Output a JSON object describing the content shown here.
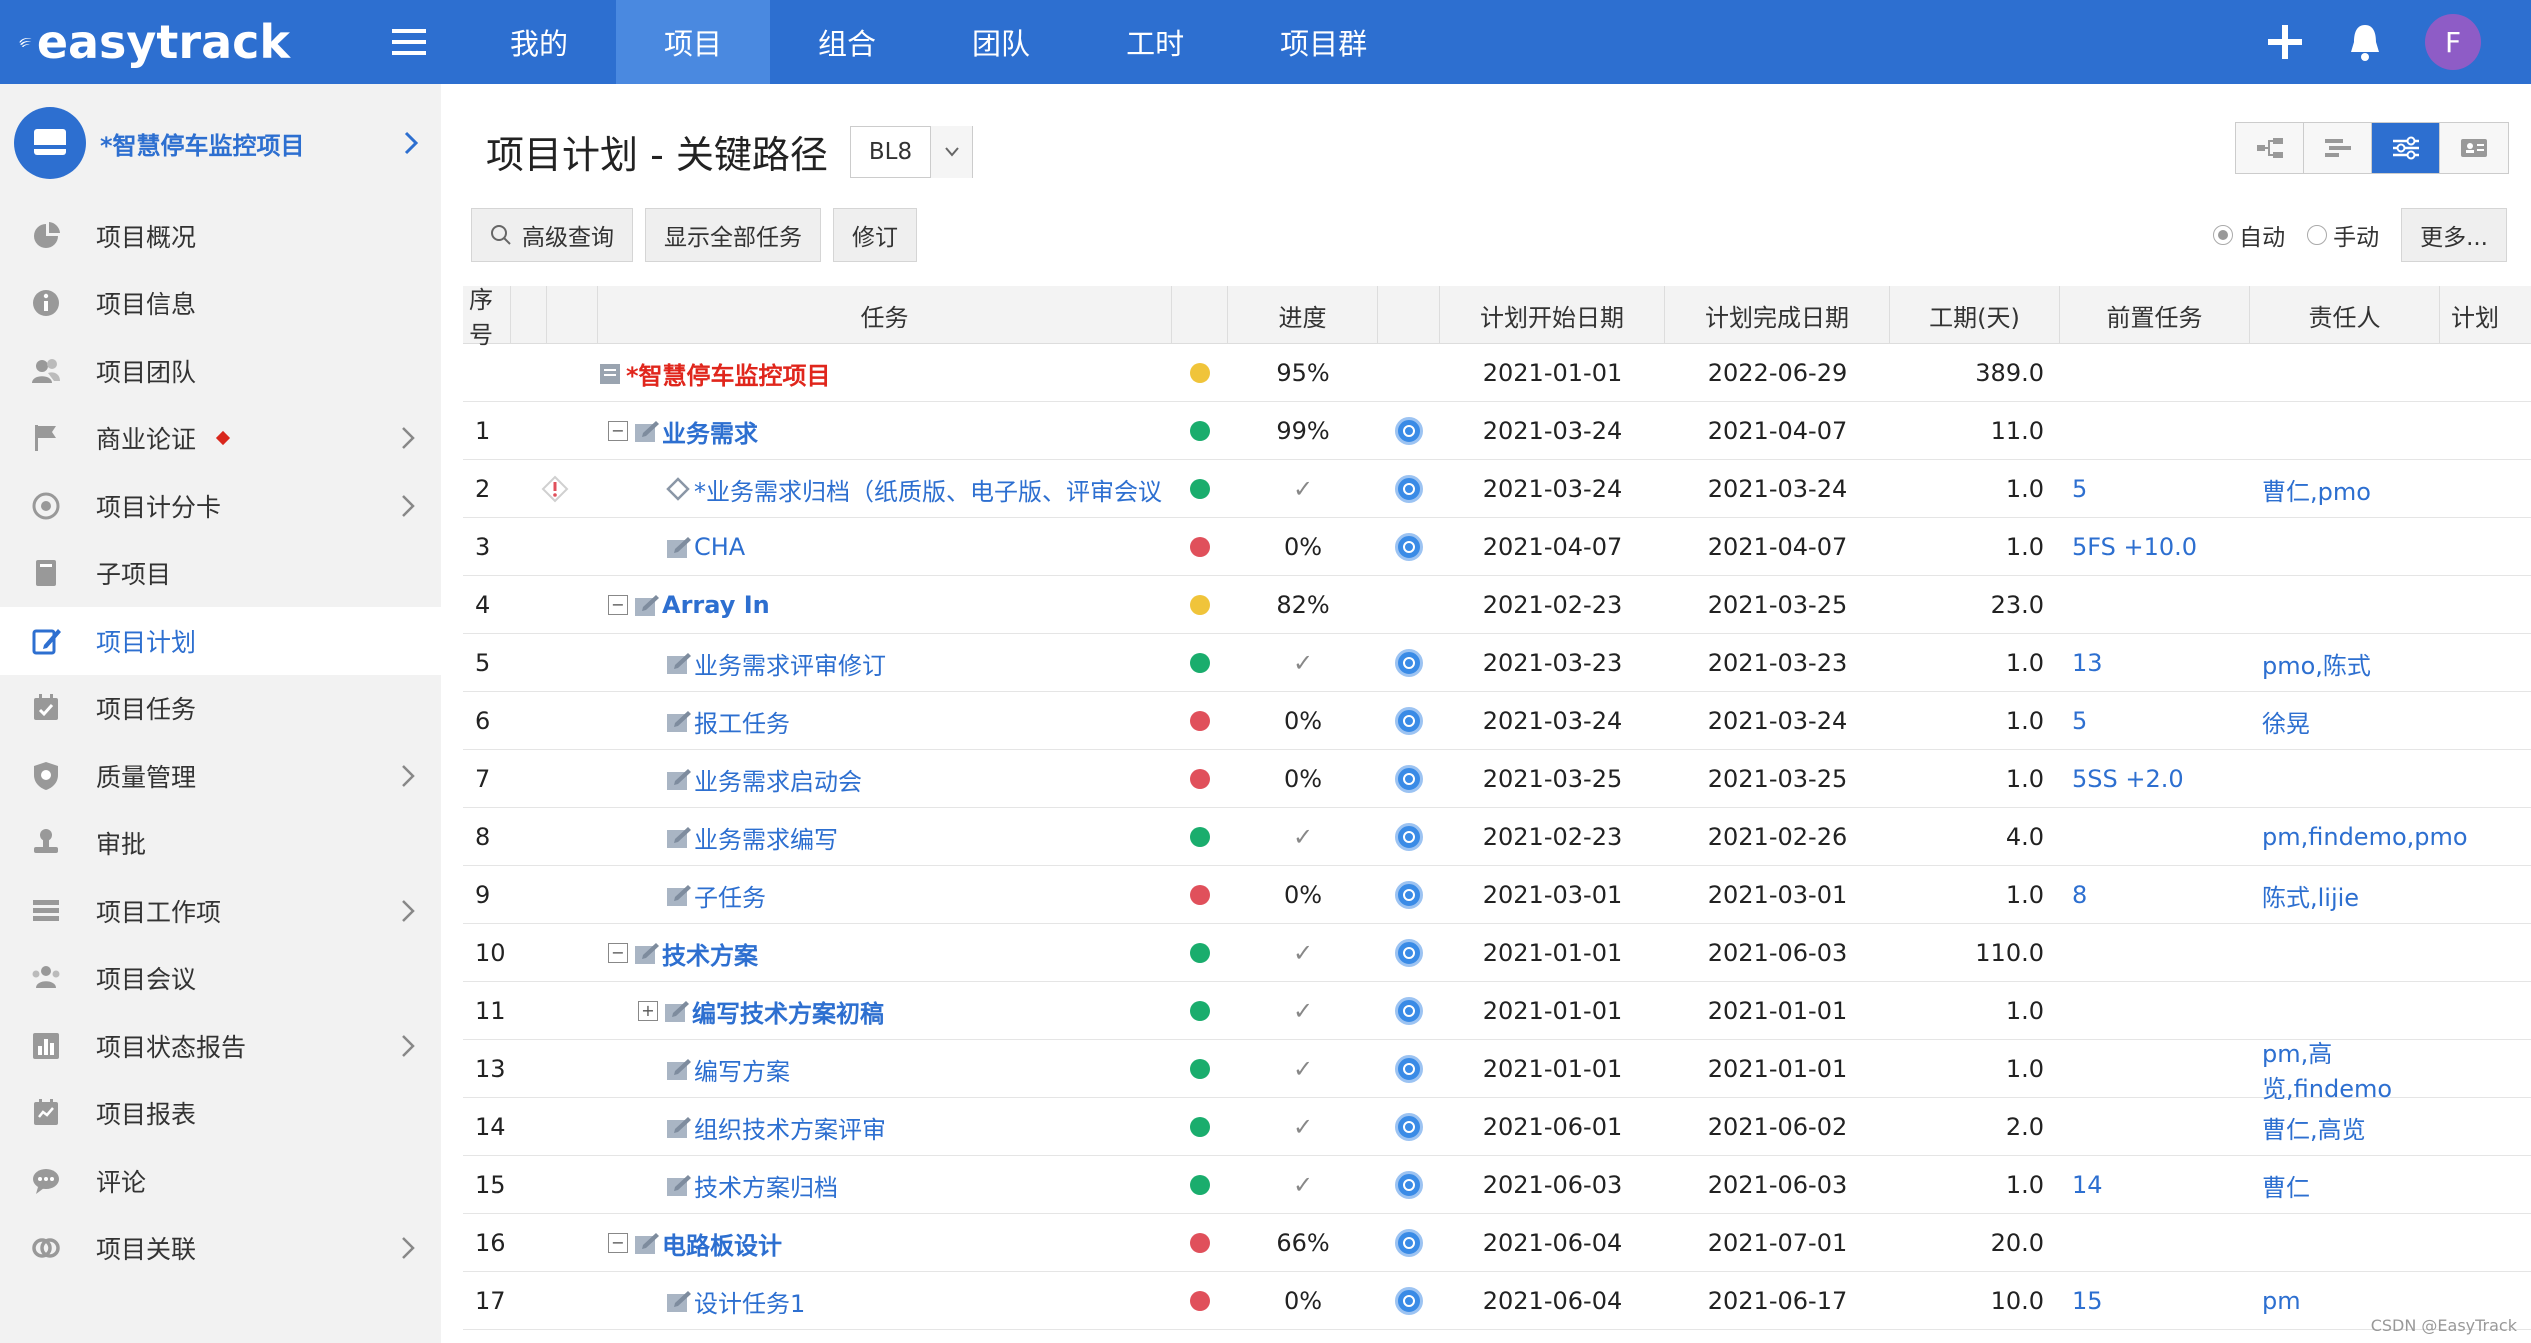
{
  "app": {
    "logo_text": "easytrack"
  },
  "topnav": {
    "tabs": [
      {
        "label": "我的",
        "active": false
      },
      {
        "label": "项目",
        "active": true
      },
      {
        "label": "组合",
        "active": false
      },
      {
        "label": "团队",
        "active": false
      },
      {
        "label": "工时",
        "active": false
      },
      {
        "label": "项目群",
        "active": false
      }
    ],
    "avatar_letter": "F",
    "accent": "#2d6fd0"
  },
  "sidebar": {
    "project_name": "*智慧停车监控项目",
    "items": [
      {
        "label": "项目概况",
        "icon": "pie-chart-icon",
        "arrow": false,
        "active": false
      },
      {
        "label": "项目信息",
        "icon": "info-icon",
        "arrow": false,
        "active": false
      },
      {
        "label": "项目团队",
        "icon": "team-icon",
        "arrow": false,
        "active": false
      },
      {
        "label": "商业论证",
        "icon": "flag-icon",
        "arrow": true,
        "active": false,
        "badge": true
      },
      {
        "label": "项目计分卡",
        "icon": "target-icon",
        "arrow": true,
        "active": false
      },
      {
        "label": "子项目",
        "icon": "book-icon",
        "arrow": false,
        "active": false
      },
      {
        "label": "项目计划",
        "icon": "edit-icon",
        "arrow": false,
        "active": true
      },
      {
        "label": "项目任务",
        "icon": "calendar-check-icon",
        "arrow": false,
        "active": false
      },
      {
        "label": "质量管理",
        "icon": "shield-icon",
        "arrow": true,
        "active": false
      },
      {
        "label": "审批",
        "icon": "stamp-icon",
        "arrow": false,
        "active": false
      },
      {
        "label": "项目工作项",
        "icon": "list-icon",
        "arrow": true,
        "active": false
      },
      {
        "label": "项目会议",
        "icon": "meeting-icon",
        "arrow": false,
        "active": false
      },
      {
        "label": "项目状态报告",
        "icon": "bar-report-icon",
        "arrow": true,
        "active": false
      },
      {
        "label": "项目报表",
        "icon": "report-icon",
        "arrow": false,
        "active": false
      },
      {
        "label": "评论",
        "icon": "comment-icon",
        "arrow": false,
        "active": false
      },
      {
        "label": "项目关联",
        "icon": "link-icon",
        "arrow": true,
        "active": false
      }
    ]
  },
  "main": {
    "title": "项目计划 - 关键路径",
    "baseline": "BL8",
    "buttons": {
      "search": "高级查询",
      "show_all": "显示全部任务",
      "revise": "修订"
    },
    "mode_auto": "自动",
    "mode_manual": "手动",
    "more": "更多..."
  },
  "grid": {
    "headers": {
      "no": "序号",
      "task": "任务",
      "progress": "进度",
      "start": "计划开始日期",
      "end": "计划完成日期",
      "duration": "工期(天)",
      "pred": "前置任务",
      "owner": "责任人",
      "plan": "计划"
    },
    "rows": [
      {
        "no": "",
        "level": 0,
        "toggle": "",
        "name": "*智慧停车监控项目",
        "style": "root",
        "status": "yellow",
        "progress": "95%",
        "badge": false,
        "start": "2021-01-01",
        "end": "2022-06-29",
        "duration": "389.0",
        "pred": "",
        "owner": "",
        "warn": false
      },
      {
        "no": "1",
        "level": 1,
        "toggle": "−",
        "name": "业务需求",
        "style": "bold",
        "status": "green",
        "progress": "99%",
        "badge": true,
        "start": "2021-03-24",
        "end": "2021-04-07",
        "duration": "11.0",
        "pred": "",
        "owner": "",
        "warn": false
      },
      {
        "no": "2",
        "level": 2,
        "toggle": "",
        "name": "*业务需求归档（纸质版、电子版、评审会议",
        "style": "milestone",
        "status": "green",
        "progress": "✓",
        "badge": true,
        "start": "2021-03-24",
        "end": "2021-03-24",
        "duration": "1.0",
        "pred": "5",
        "owner": "曹仁,pmo",
        "warn": true
      },
      {
        "no": "3",
        "level": 2,
        "toggle": "",
        "name": "CHA",
        "style": "normal",
        "status": "red",
        "progress": "0%",
        "badge": true,
        "start": "2021-04-07",
        "end": "2021-04-07",
        "duration": "1.0",
        "pred": "5FS +10.0",
        "owner": "",
        "warn": false
      },
      {
        "no": "4",
        "level": 1,
        "toggle": "−",
        "name": "Array In",
        "style": "bold",
        "status": "yellow",
        "progress": "82%",
        "badge": false,
        "start": "2021-02-23",
        "end": "2021-03-25",
        "duration": "23.0",
        "pred": "",
        "owner": "",
        "warn": false
      },
      {
        "no": "5",
        "level": 2,
        "toggle": "",
        "name": "业务需求评审修订",
        "style": "normal",
        "status": "green",
        "progress": "✓",
        "badge": true,
        "start": "2021-03-23",
        "end": "2021-03-23",
        "duration": "1.0",
        "pred": "13",
        "owner": "pmo,陈式",
        "warn": false
      },
      {
        "no": "6",
        "level": 2,
        "toggle": "",
        "name": "报工任务",
        "style": "normal",
        "status": "red",
        "progress": "0%",
        "badge": true,
        "start": "2021-03-24",
        "end": "2021-03-24",
        "duration": "1.0",
        "pred": "5",
        "owner": "徐晃",
        "warn": false
      },
      {
        "no": "7",
        "level": 2,
        "toggle": "",
        "name": "业务需求启动会",
        "style": "normal",
        "status": "red",
        "progress": "0%",
        "badge": true,
        "start": "2021-03-25",
        "end": "2021-03-25",
        "duration": "1.0",
        "pred": "5SS +2.0",
        "owner": "",
        "warn": false
      },
      {
        "no": "8",
        "level": 2,
        "toggle": "",
        "name": "业务需求编写",
        "style": "normal",
        "status": "green",
        "progress": "✓",
        "badge": true,
        "start": "2021-02-23",
        "end": "2021-02-26",
        "duration": "4.0",
        "pred": "",
        "owner": "pm,findemo,pmo",
        "warn": false
      },
      {
        "no": "9",
        "level": 2,
        "toggle": "",
        "name": "子任务",
        "style": "normal",
        "status": "red",
        "progress": "0%",
        "badge": true,
        "start": "2021-03-01",
        "end": "2021-03-01",
        "duration": "1.0",
        "pred": "8",
        "owner": "陈式,lijie",
        "warn": false
      },
      {
        "no": "10",
        "level": 1,
        "toggle": "−",
        "name": "技术方案",
        "style": "bold",
        "status": "green",
        "progress": "✓",
        "badge": true,
        "start": "2021-01-01",
        "end": "2021-06-03",
        "duration": "110.0",
        "pred": "",
        "owner": "",
        "warn": false
      },
      {
        "no": "11",
        "level": 2,
        "toggle": "+",
        "name": "编写技术方案初稿",
        "style": "bold",
        "status": "green",
        "progress": "✓",
        "badge": true,
        "start": "2021-01-01",
        "end": "2021-01-01",
        "duration": "1.0",
        "pred": "",
        "owner": "",
        "warn": false
      },
      {
        "no": "13",
        "level": 2,
        "toggle": "",
        "name": "编写方案",
        "style": "normal",
        "status": "green",
        "progress": "✓",
        "badge": true,
        "start": "2021-01-01",
        "end": "2021-01-01",
        "duration": "1.0",
        "pred": "",
        "owner": "pm,高览,findemo",
        "warn": false
      },
      {
        "no": "14",
        "level": 2,
        "toggle": "",
        "name": "组织技术方案评审",
        "style": "normal",
        "status": "green",
        "progress": "✓",
        "badge": true,
        "start": "2021-06-01",
        "end": "2021-06-02",
        "duration": "2.0",
        "pred": "",
        "owner": "曹仁,高览",
        "warn": false
      },
      {
        "no": "15",
        "level": 2,
        "toggle": "",
        "name": "技术方案归档",
        "style": "normal",
        "status": "green",
        "progress": "✓",
        "badge": true,
        "start": "2021-06-03",
        "end": "2021-06-03",
        "duration": "1.0",
        "pred": "14",
        "owner": "曹仁",
        "warn": false
      },
      {
        "no": "16",
        "level": 1,
        "toggle": "−",
        "name": "电路板设计",
        "style": "bold",
        "status": "red",
        "progress": "66%",
        "badge": true,
        "start": "2021-06-04",
        "end": "2021-07-01",
        "duration": "20.0",
        "pred": "",
        "owner": "",
        "warn": false
      },
      {
        "no": "17",
        "level": 2,
        "toggle": "",
        "name": "设计任务1",
        "style": "normal",
        "status": "red",
        "progress": "0%",
        "badge": true,
        "start": "2021-06-04",
        "end": "2021-06-17",
        "duration": "10.0",
        "pred": "15",
        "owner": "pm",
        "warn": false
      }
    ]
  },
  "watermark": "CSDN @EasyTrack"
}
